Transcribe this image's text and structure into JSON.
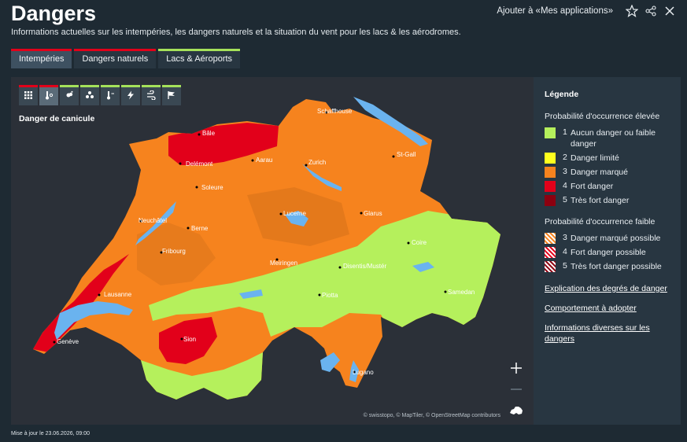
{
  "header": {
    "title": "Dangers",
    "subtitle": "Informations actuelles sur les intempéries, les dangers naturels et la situation du vent pour les lacs & les aérodromes.",
    "add_apps_label": "Ajouter à «Mes applications»"
  },
  "tabs": [
    {
      "label": "Intempéries"
    },
    {
      "label": "Dangers naturels"
    },
    {
      "label": "Lacs & Aéroports"
    }
  ],
  "map": {
    "title": "Danger de canicule",
    "attribution": "© swisstopo, © MapTiler, © OpenStreetMap contributors",
    "cities": [
      "Schaffhouse",
      "Bâle",
      "Delémont",
      "Aarau",
      "Zurich",
      "St-Gall",
      "Soleure",
      "Neuchâtel",
      "Berne",
      "Lucerne",
      "Glarus",
      "Coire",
      "Fribourg",
      "Meiringen",
      "Disentis/Mustér",
      "Lausanne",
      "Piotta",
      "Samedan",
      "Genève",
      "Sion",
      "Lugano"
    ]
  },
  "legend": {
    "title": "Légende",
    "high_title": "Probabilité d'occurrence élevée",
    "high_items": [
      {
        "num": "1",
        "label": "Aucun danger ou faible danger",
        "color": "#b5f05c"
      },
      {
        "num": "2",
        "label": "Danger limité",
        "color": "#ffff1e"
      },
      {
        "num": "3",
        "label": "Danger marqué",
        "color": "#f6831e"
      },
      {
        "num": "4",
        "label": "Fort danger",
        "color": "#e2001a"
      },
      {
        "num": "5",
        "label": "Très fort danger",
        "color": "#8c0010"
      }
    ],
    "low_title": "Probabilité d'occurrence faible",
    "low_items": [
      {
        "num": "3",
        "label": "Danger marqué possible",
        "color": "#f6831e"
      },
      {
        "num": "4",
        "label": "Fort danger possible",
        "color": "#e2001a"
      },
      {
        "num": "5",
        "label": "Très fort danger possible",
        "color": "#8c0010"
      }
    ],
    "links": [
      "Explication des degrés de danger",
      "Comportement à adopter",
      "Informations diverses sur les dangers"
    ]
  },
  "footer": {
    "updated": "Mise à jour le 23.06.2026, 09:00"
  }
}
